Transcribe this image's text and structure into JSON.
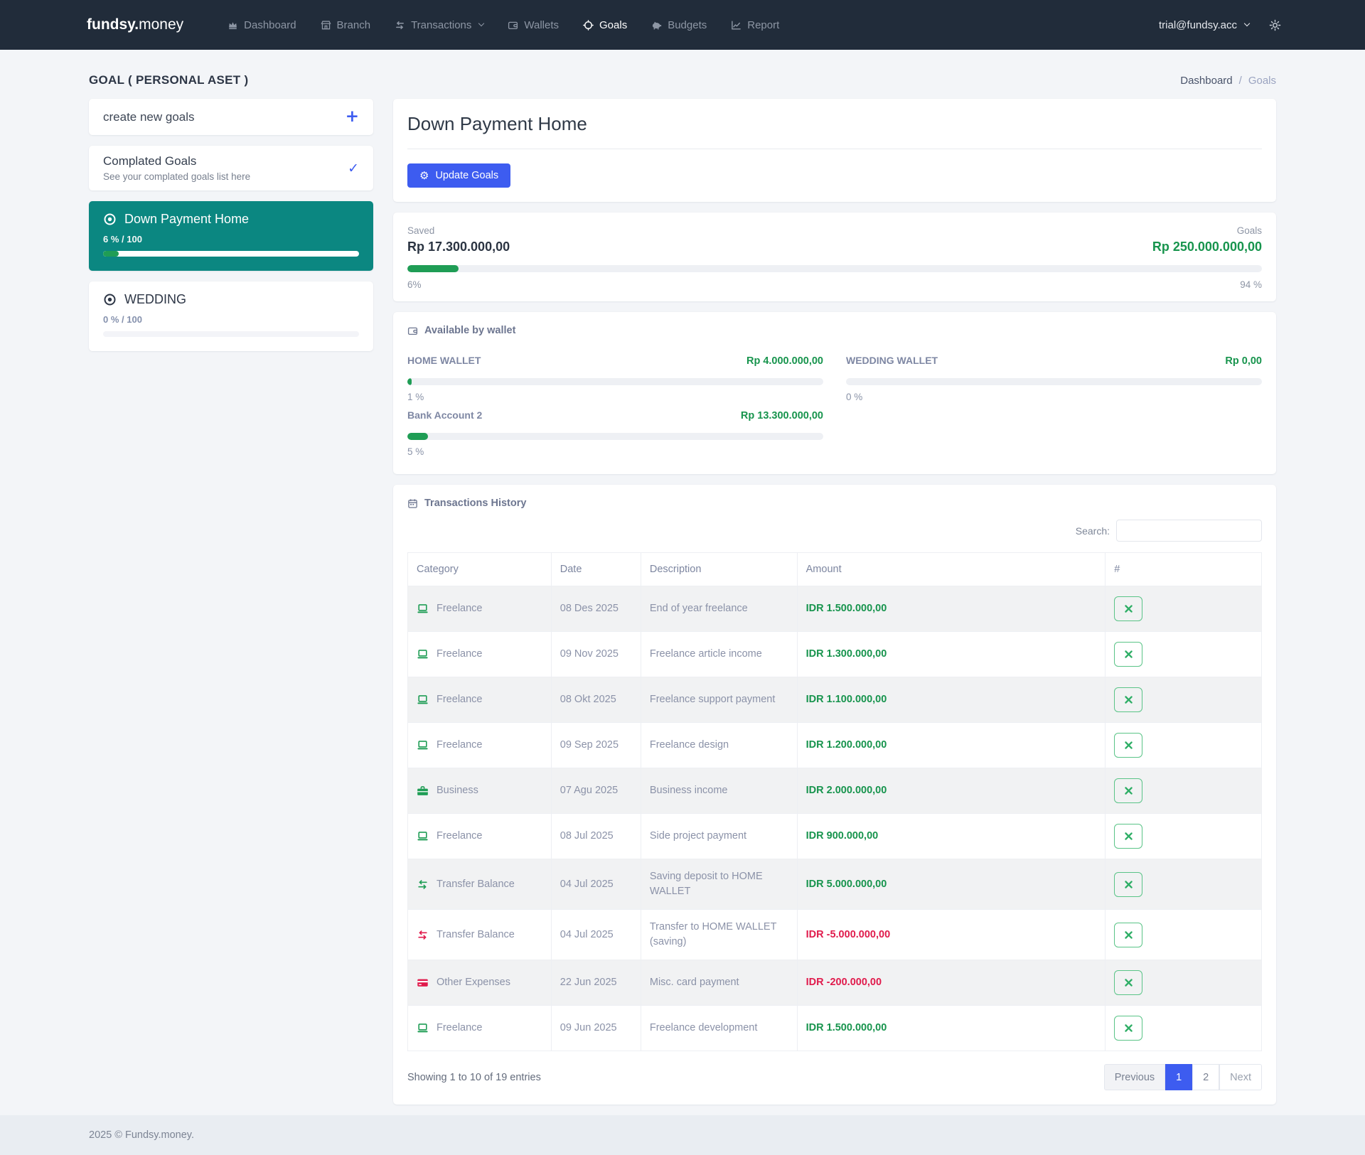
{
  "navbar": {
    "brand_bold": "fundsy.",
    "brand_light": "money",
    "items": [
      {
        "label": "Dashboard",
        "icon": "dashboard-icon",
        "active": false
      },
      {
        "label": "Branch",
        "icon": "branch-icon",
        "active": false
      },
      {
        "label": "Transactions",
        "icon": "transactions-icon",
        "active": false,
        "caret": true
      },
      {
        "label": "Wallets",
        "icon": "wallets-icon",
        "active": false
      },
      {
        "label": "Goals",
        "icon": "goals-icon",
        "active": true
      },
      {
        "label": "Budgets",
        "icon": "budgets-icon",
        "active": false
      },
      {
        "label": "Report",
        "icon": "report-icon",
        "active": false
      }
    ],
    "account_label": "trial@fundsy.acc",
    "theme_icon": "sun-icon"
  },
  "page": {
    "heading": "GOAL ( PERSONAL ASET )",
    "breadcrumb_parent": "Dashboard",
    "breadcrumb_sep": "/",
    "breadcrumb_current": "Goals"
  },
  "sidebar": {
    "create": {
      "label": "create new goals",
      "icon": "plus-icon",
      "plus_glyph": "+"
    },
    "completed": {
      "title": "Complated Goals",
      "subtitle": "See your complated goals list here",
      "icon": "check-icon",
      "check_glyph": "✓"
    },
    "goals": [
      {
        "name": "Down Payment Home",
        "icon": "bullseye-icon",
        "progress_label": "6 % / 100",
        "percent": 6,
        "active": true
      },
      {
        "name": "WEDDING",
        "icon": "bullseye-icon",
        "progress_label": "0 % / 100",
        "percent": 0,
        "active": false
      }
    ]
  },
  "main": {
    "title": "Down Payment Home",
    "update_button": {
      "label": "Update Goals",
      "icon": "gear-icon",
      "gear_glyph": "⚙"
    },
    "summary": {
      "saved_label": "Saved",
      "saved_value": "Rp 17.300.000,00",
      "goals_label": "Goals",
      "goals_value": "Rp 250.000.000,00",
      "percent": 6,
      "percent_left": "6%",
      "percent_right": "94 %"
    },
    "wallets": {
      "title": "Available by wallet",
      "icon": "wallet-icon",
      "items": [
        {
          "name": "HOME WALLET",
          "value": "Rp 4.000.000,00",
          "percent": 1,
          "percent_label": "1 %"
        },
        {
          "name": "Bank Account 2",
          "value": "Rp 13.300.000,00",
          "percent": 5,
          "percent_label": "5 %"
        },
        {
          "name": "WEDDING WALLET",
          "value": "Rp 0,00",
          "percent": 0,
          "percent_label": "0 %"
        }
      ]
    },
    "transactions": {
      "title": "Transactions History",
      "icon": "calendar-icon",
      "search_label": "Search:",
      "search_value": "",
      "columns": [
        "Category",
        "Date",
        "Description",
        "Amount",
        "#"
      ],
      "action_icon": "tools-icon",
      "rows": [
        {
          "category": "Freelance",
          "icon": "laptop-icon",
          "icon_tone": "pos",
          "date": "08 Des 2025",
          "description": "End of year freelance",
          "amount": "IDR 1.500.000,00",
          "tone": "pos"
        },
        {
          "category": "Freelance",
          "icon": "laptop-icon",
          "icon_tone": "pos",
          "date": "09 Nov 2025",
          "description": "Freelance article income",
          "amount": "IDR 1.300.000,00",
          "tone": "pos"
        },
        {
          "category": "Freelance",
          "icon": "laptop-icon",
          "icon_tone": "pos",
          "date": "08 Okt 2025",
          "description": "Freelance support payment",
          "amount": "IDR 1.100.000,00",
          "tone": "pos"
        },
        {
          "category": "Freelance",
          "icon": "laptop-icon",
          "icon_tone": "pos",
          "date": "09 Sep 2025",
          "description": "Freelance design",
          "amount": "IDR 1.200.000,00",
          "tone": "pos"
        },
        {
          "category": "Business",
          "icon": "briefcase-icon",
          "icon_tone": "pos",
          "date": "07 Agu 2025",
          "description": "Business income",
          "amount": "IDR 2.000.000,00",
          "tone": "pos"
        },
        {
          "category": "Freelance",
          "icon": "laptop-icon",
          "icon_tone": "pos",
          "date": "08 Jul 2025",
          "description": "Side project payment",
          "amount": "IDR 900.000,00",
          "tone": "pos"
        },
        {
          "category": "Transfer Balance",
          "icon": "transfer-icon",
          "icon_tone": "pos",
          "date": "04 Jul 2025",
          "description": "Saving deposit to HOME WALLET",
          "amount": "IDR 5.000.000,00",
          "tone": "pos"
        },
        {
          "category": "Transfer Balance",
          "icon": "transfer-icon",
          "icon_tone": "neg",
          "date": "04 Jul 2025",
          "description": "Transfer to HOME WALLET (saving)",
          "amount": "IDR -5.000.000,00",
          "tone": "neg"
        },
        {
          "category": "Other Expenses",
          "icon": "credit-card-icon",
          "icon_tone": "neg",
          "date": "22 Jun 2025",
          "description": "Misc. card payment",
          "amount": "IDR -200.000,00",
          "tone": "neg"
        },
        {
          "category": "Freelance",
          "icon": "laptop-icon",
          "icon_tone": "pos",
          "date": "09 Jun 2025",
          "description": "Freelance development",
          "amount": "IDR 1.500.000,00",
          "tone": "pos"
        }
      ],
      "showing": "Showing 1 to 10 of 19 entries",
      "pagination": {
        "prev": "Previous",
        "pages": [
          "1",
          "2"
        ],
        "active": "1",
        "next": "Next"
      }
    }
  },
  "footer": {
    "copyright": "2025 © Fundsy.money."
  },
  "colors": {
    "navbar_bg": "#212c3a",
    "accent_blue": "#3d5cf0",
    "active_goal_teal": "#0b8781",
    "progress_green": "#1f9d55",
    "money_green": "#17944d",
    "negative_red": "#e01b4c",
    "page_bg": "#f3f5f8",
    "footer_bg": "#e9edf2"
  }
}
